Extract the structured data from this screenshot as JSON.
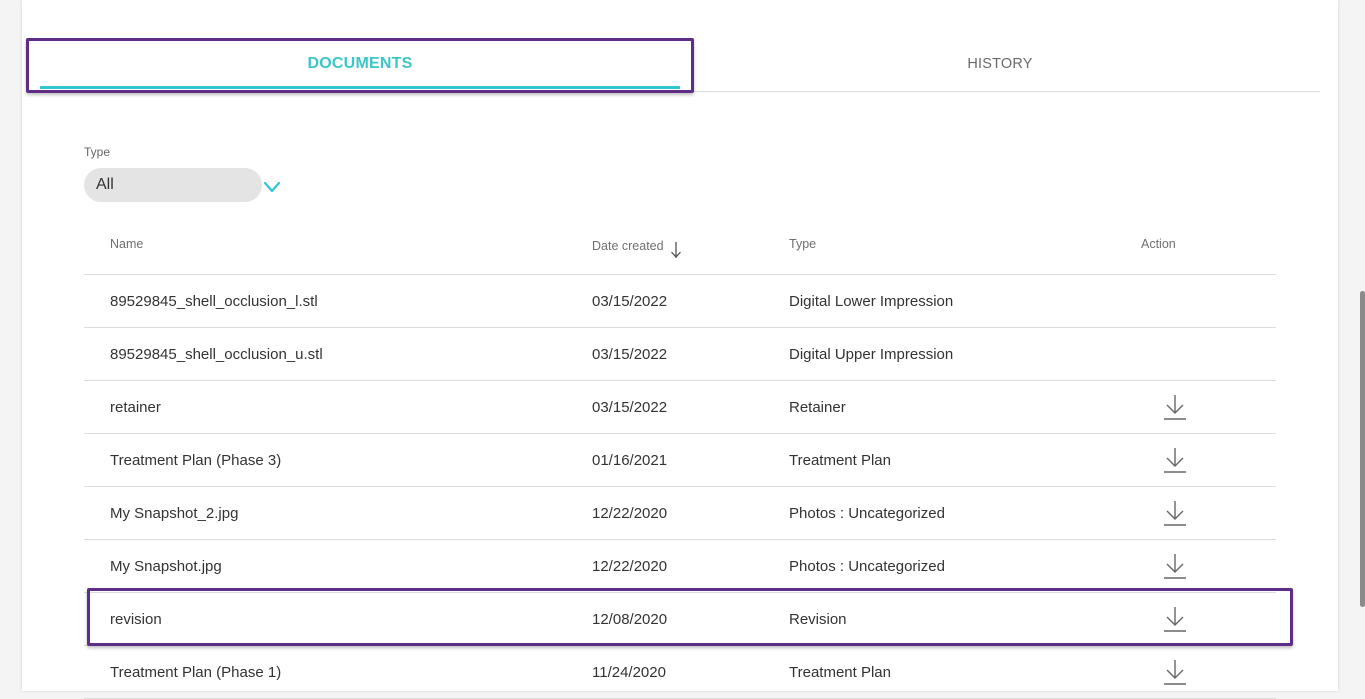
{
  "tabs": {
    "documents_label": "DOCUMENTS",
    "history_label": "HISTORY"
  },
  "filter": {
    "label": "Type",
    "selected": "All"
  },
  "table": {
    "headers": {
      "name": "Name",
      "date": "Date created",
      "type": "Type",
      "action": "Action"
    },
    "rows": [
      {
        "name": "89529845_shell_occlusion_l.stl",
        "date": "03/15/2022",
        "type": "Digital Lower Impression",
        "downloadable": false
      },
      {
        "name": "89529845_shell_occlusion_u.stl",
        "date": "03/15/2022",
        "type": "Digital Upper Impression",
        "downloadable": false
      },
      {
        "name": "retainer",
        "date": "03/15/2022",
        "type": "Retainer",
        "downloadable": true
      },
      {
        "name": "Treatment Plan (Phase 3)",
        "date": "01/16/2021",
        "type": "Treatment Plan",
        "downloadable": true
      },
      {
        "name": "My Snapshot_2.jpg",
        "date": "12/22/2020",
        "type": "Photos : Uncategorized",
        "downloadable": true
      },
      {
        "name": "My Snapshot.jpg",
        "date": "12/22/2020",
        "type": "Photos : Uncategorized",
        "downloadable": true
      },
      {
        "name": "revision",
        "date": "12/08/2020",
        "type": "Revision",
        "downloadable": true
      },
      {
        "name": "Treatment Plan (Phase 1)",
        "date": "11/24/2020",
        "type": "Treatment Plan",
        "downloadable": true
      }
    ]
  },
  "colors": {
    "accent": "#2fc6d2",
    "highlight": "#5e2d86"
  },
  "icons": {
    "sort": "sort-arrow-down-icon",
    "download": "download-icon",
    "dropdown": "chevron-down-icon"
  }
}
